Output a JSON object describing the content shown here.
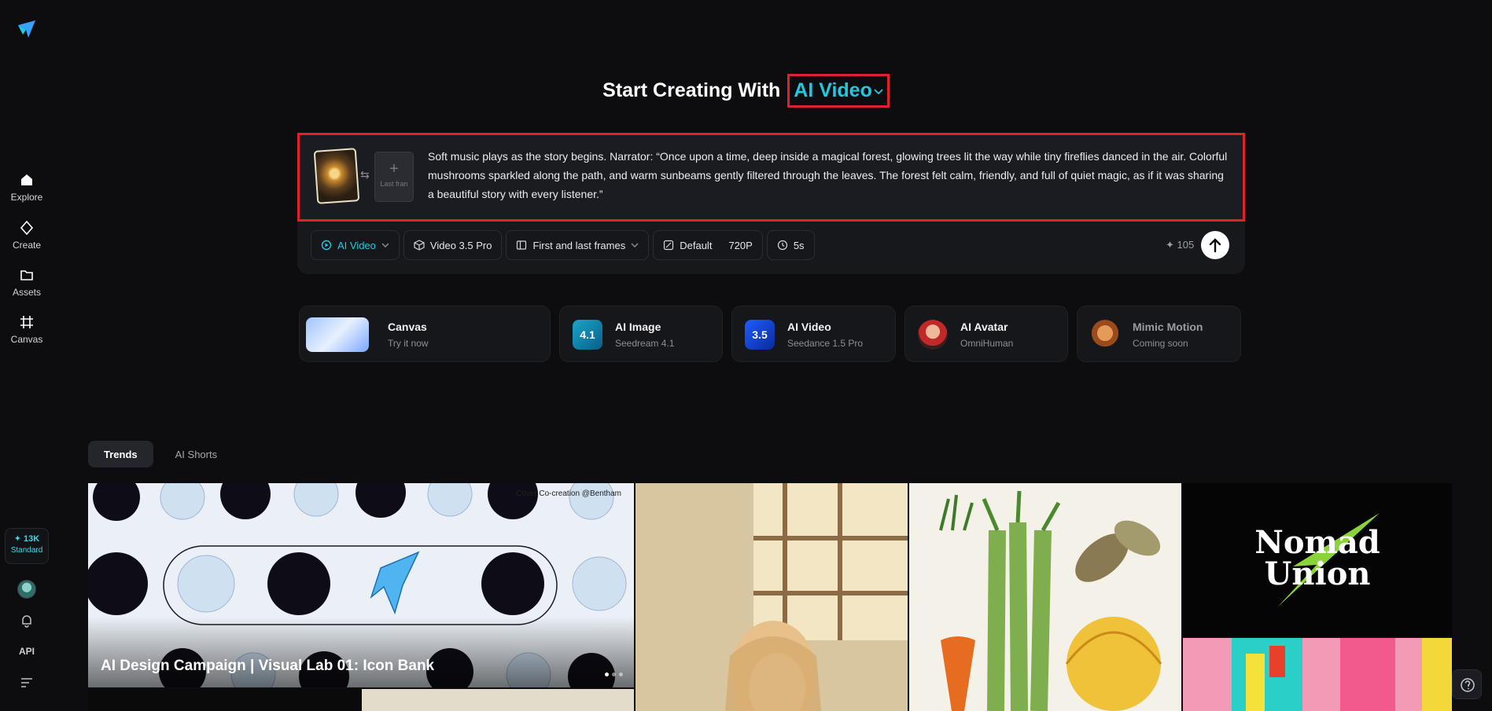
{
  "sidebar": {
    "items": [
      {
        "label": "Explore",
        "icon": "home-icon"
      },
      {
        "label": "Create",
        "icon": "sparkle-icon"
      },
      {
        "label": "Assets",
        "icon": "folder-icon"
      },
      {
        "label": "Canvas",
        "icon": "canvas-icon"
      }
    ],
    "credits": {
      "amount": "✦ 13K",
      "tier": "Standard"
    },
    "api_label": "API"
  },
  "heading": {
    "prefix": "Start Creating With",
    "mode": "AI Video"
  },
  "prompt": {
    "text": "Soft music plays as the story begins. Narrator: “Once upon a time, deep inside a magical forest, glowing trees lit the way while tiny fireflies danced in the air. Colorful mushrooms sparkled along the path, and warm sunbeams gently filtered through the leaves. The forest felt calm, friendly, and full of quiet magic, as if it was sharing a beautiful story with every listener.”",
    "last_frame_label": "Last fran",
    "plus": "+",
    "swap": "⇆"
  },
  "toolbar": {
    "mode": "AI Video",
    "model": "Video 3.5 Pro",
    "frames": "First and last frames",
    "ratio": "Default",
    "resolution": "720P",
    "duration": "5s",
    "cost": "✦ 105"
  },
  "cards": [
    {
      "title": "Canvas",
      "sub": "Try it now"
    },
    {
      "title": "AI Image",
      "sub": "Seedream 4.1",
      "badge": "4.1"
    },
    {
      "title": "AI Video",
      "sub": "Seedance 1.5 Pro",
      "badge": "3.5"
    },
    {
      "title": "AI Avatar",
      "sub": "OmniHuman"
    },
    {
      "title": "Mimic Motion",
      "sub": "Coming soon"
    }
  ],
  "tabs": [
    {
      "label": "Trends",
      "active": true
    },
    {
      "label": "AI Shorts",
      "active": false
    }
  ],
  "gallery": {
    "featured_caption": "AI Design Campaign | Visual Lab 01: Icon Bank",
    "featured_credit": "Cover Co-creation @Bentham",
    "nomad_line1": "Nomad",
    "nomad_line2": "Union"
  },
  "colors": {
    "accent": "#22c8e0",
    "highlight": "#e0202a",
    "background": "#0d0d0f"
  }
}
